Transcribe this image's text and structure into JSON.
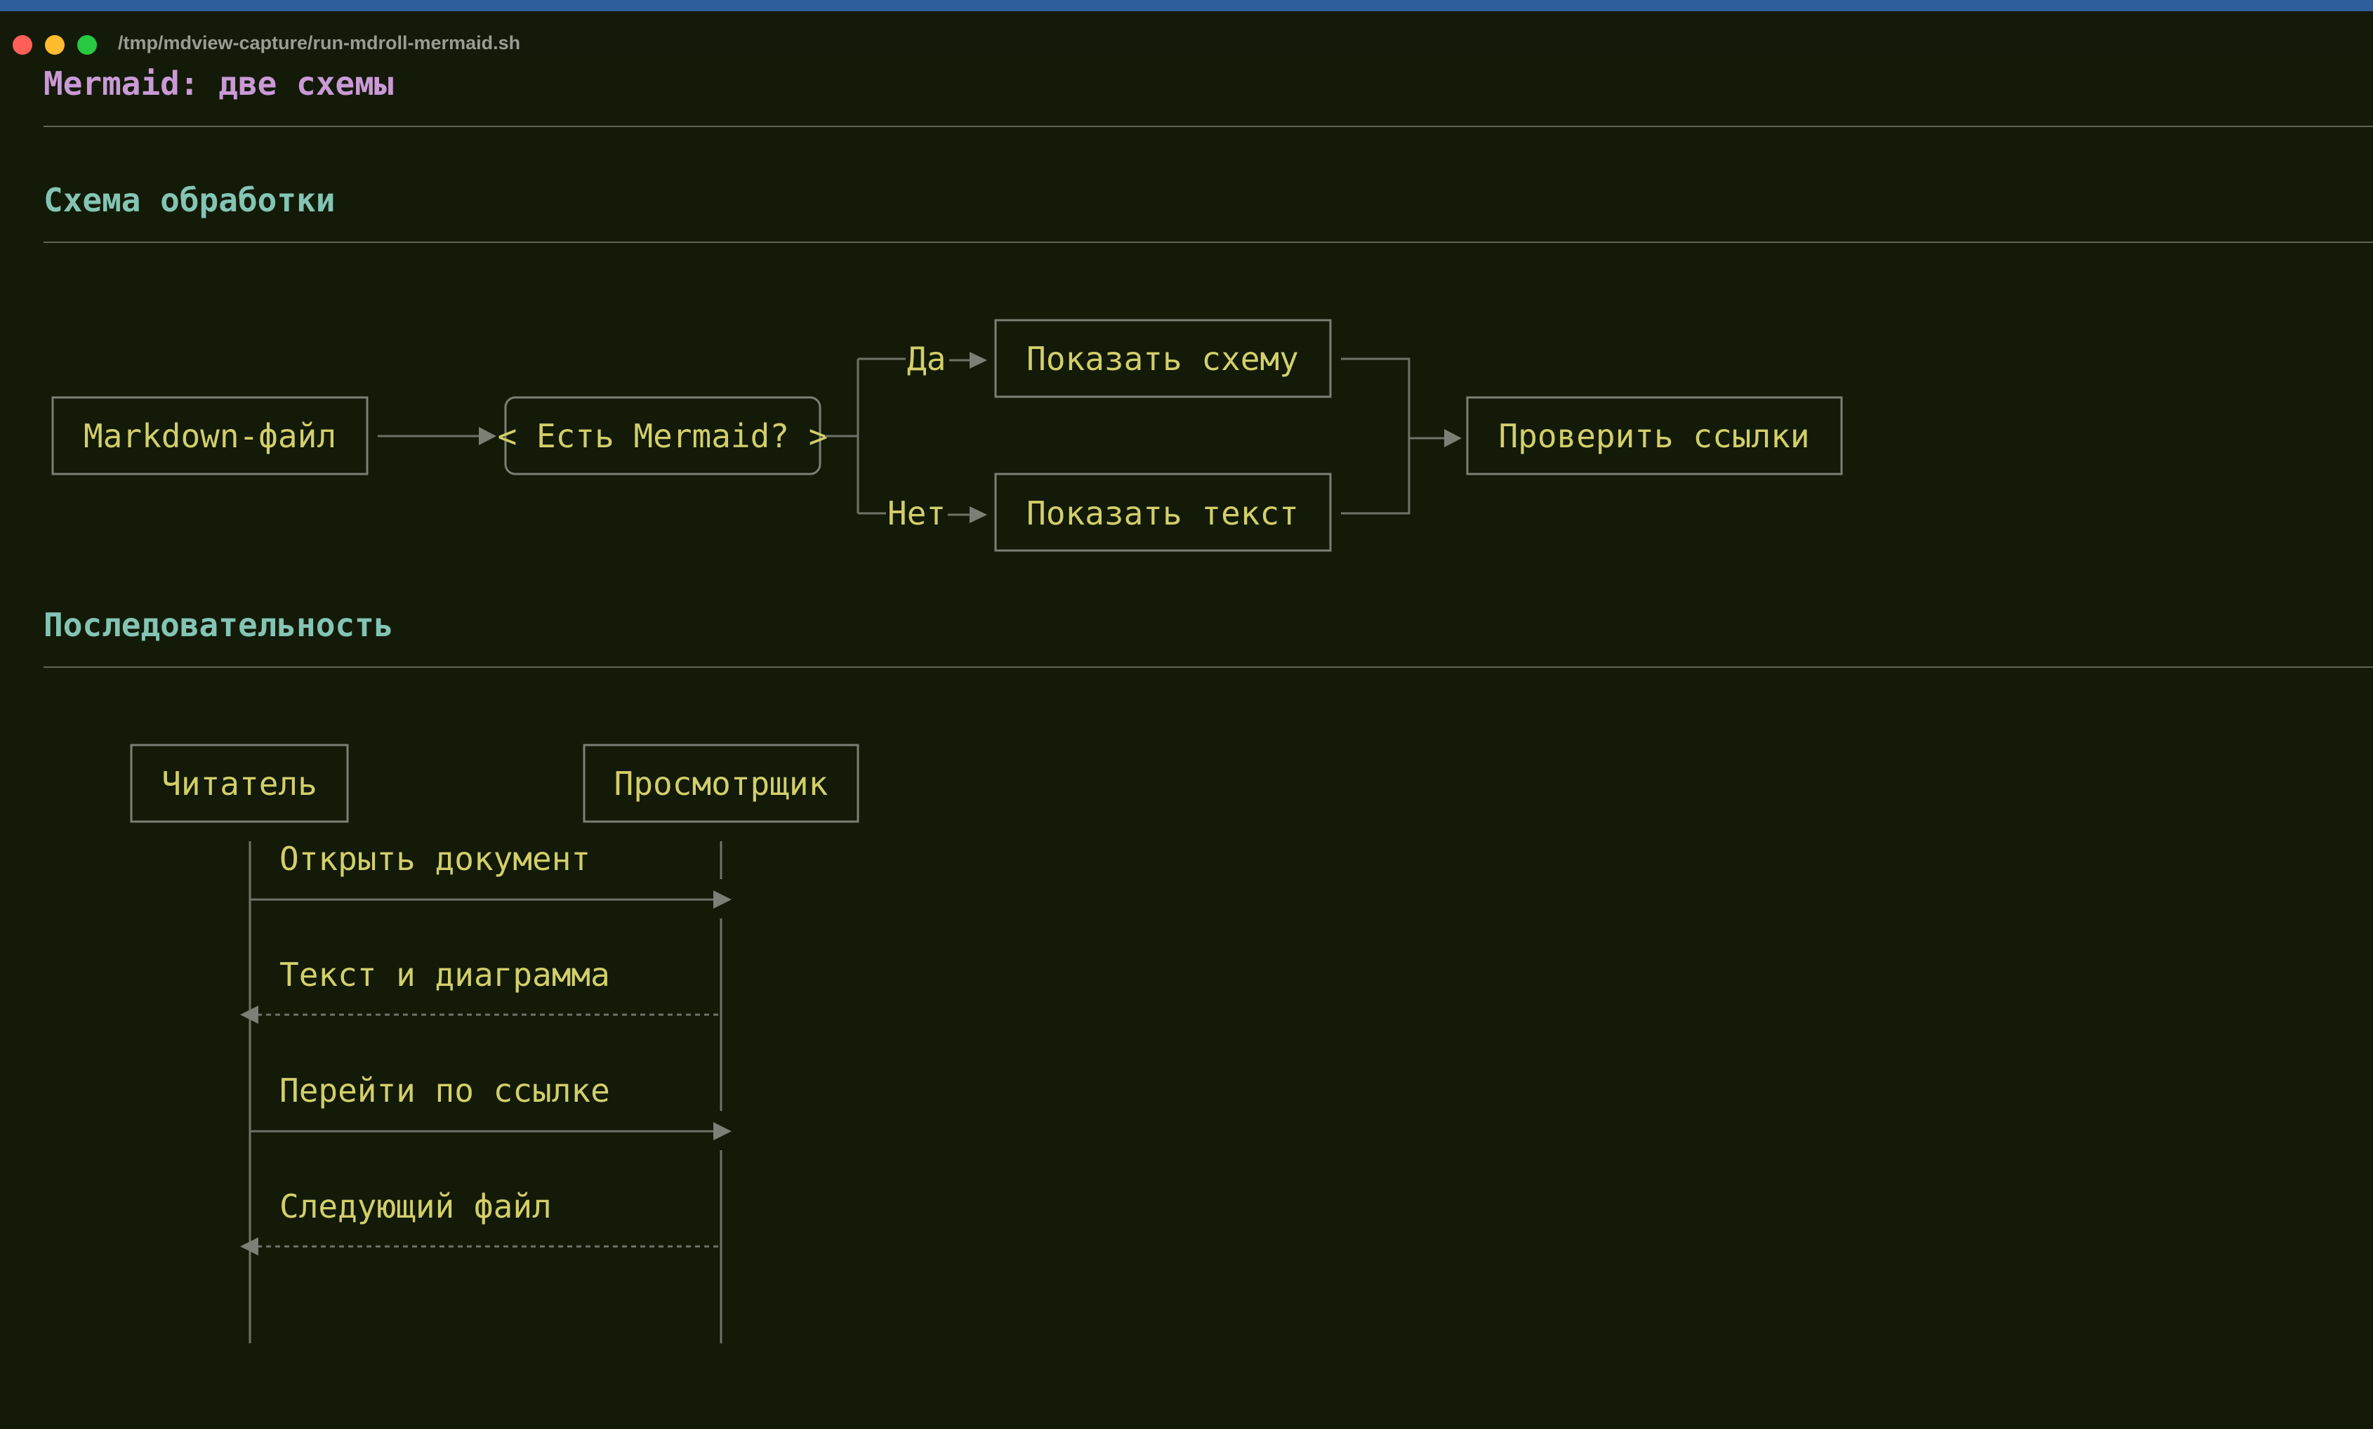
{
  "window": {
    "title": "/tmp/mdview-capture/run-mdroll-mermaid.sh"
  },
  "document": {
    "title": "Mermaid: две схемы",
    "sections": [
      {
        "heading": "Схема обработки"
      },
      {
        "heading": "Последовательность"
      }
    ]
  },
  "flowchart": {
    "nodes": {
      "start": "Markdown-файл",
      "decision": "< Есть Mermaid? >",
      "yes_target": "Показать схему",
      "no_target": "Показать текст",
      "end": "Проверить ссылки"
    },
    "edge_labels": {
      "yes": "Да",
      "no": "Нет"
    }
  },
  "sequence": {
    "participants": [
      "Читатель",
      "Просмотрщик"
    ],
    "messages": [
      {
        "text": "Открыть документ",
        "direction": "right",
        "style": "solid"
      },
      {
        "text": "Текст и диаграмма",
        "direction": "left",
        "style": "dashed"
      },
      {
        "text": "Перейти по ссылке",
        "direction": "right",
        "style": "solid"
      },
      {
        "text": "Следующий файл",
        "direction": "left",
        "style": "dashed"
      }
    ]
  },
  "colors": {
    "background": "#131a08",
    "document_title": "#c99ad6",
    "section_heading": "#84c4b4",
    "diagram_text": "#d2cf6a",
    "diagram_lines": "#7c7f74"
  }
}
